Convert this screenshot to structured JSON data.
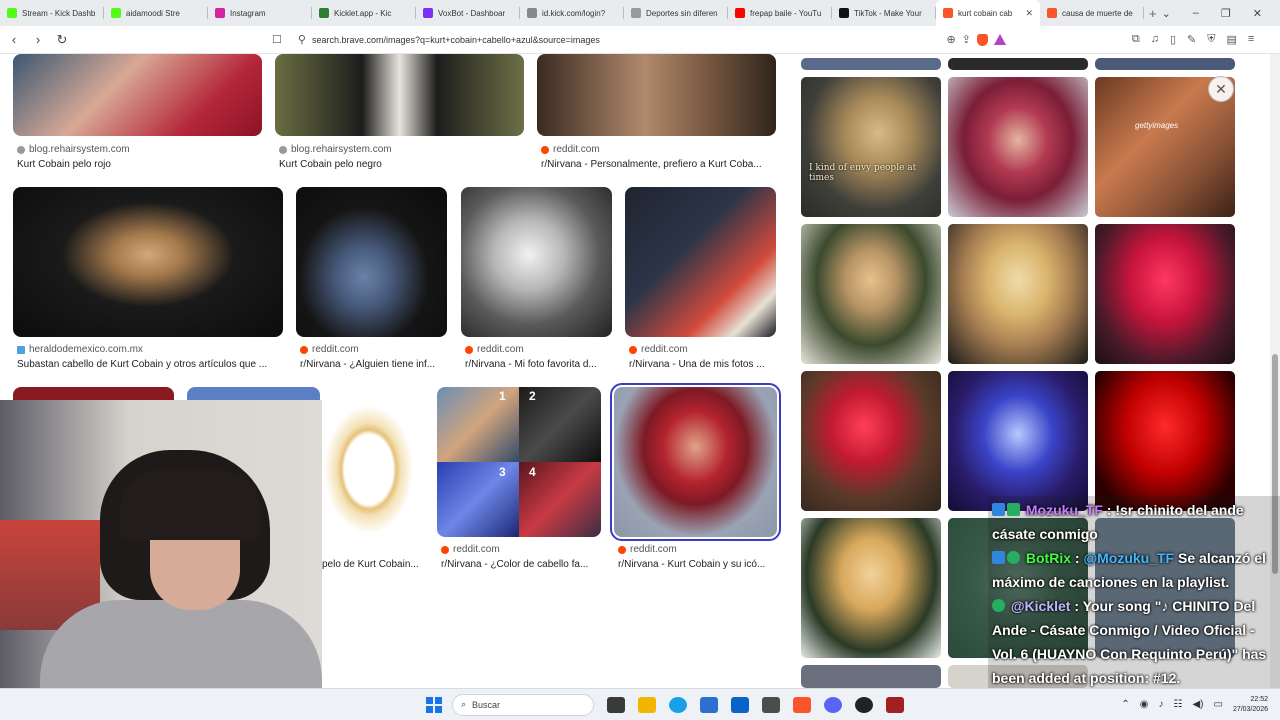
{
  "tabs": [
    {
      "label": "Stream - Kick Dashb",
      "color": "#53fc18",
      "active": false
    },
    {
      "label": "aidamoodi Stre",
      "color": "#53fc18",
      "active": false
    },
    {
      "label": "Instagram",
      "color": "#d6249f",
      "active": false
    },
    {
      "label": "Kicklet.app - Kic",
      "color": "#2e7d32",
      "active": false
    },
    {
      "label": "VoxBot - Dashboar",
      "color": "#7b2ff7",
      "active": false
    },
    {
      "label": "id.kick.com/login?",
      "color": "#888888",
      "active": false
    },
    {
      "label": "Deportes sin diferen",
      "color": "#999999",
      "active": false
    },
    {
      "label": "frepap baile - YouTu",
      "color": "#ff0000",
      "active": false
    },
    {
      "label": "TikTok - Make Your",
      "color": "#111111",
      "active": false
    },
    {
      "label": "kurt cobain cab",
      "color": "#fb542b",
      "active": true
    },
    {
      "label": "causa de muerte de",
      "color": "#fb542b",
      "active": false
    }
  ],
  "tab_close": "✕",
  "tab_plus": "+",
  "window_controls": [
    "⌄",
    "–",
    "❐",
    "✕"
  ],
  "toolbar": {
    "back": "‹",
    "forward": "›",
    "reload": "↻",
    "bookmark": "☐",
    "url": "search.brave.com/images?q=kurt+cobain+cabello+azul&source=images"
  },
  "results": [
    {
      "source": "blog.rehairsystem.com",
      "caption": "Kurt Cobain pelo rojo",
      "icon": "rehair-favicon",
      "color": "#9a9a9a"
    },
    {
      "source": "blog.rehairsystem.com",
      "caption": "Kurt Cobain pelo negro",
      "icon": "rehair-favicon",
      "color": "#9a9a9a"
    },
    {
      "source": "reddit.com",
      "caption": "r/Nirvana - Personalmente, prefiero a Kurt Coba...",
      "icon": "reddit-favicon",
      "color": "#ff4500"
    },
    {
      "source": "heraldodemexico.com.mx",
      "caption": "Subastan cabello de Kurt Cobain y otros artículos que ...",
      "icon": "heraldo-favicon",
      "color": "#4aa3df"
    },
    {
      "source": "reddit.com",
      "caption": "r/Nirvana - ¿Alguien tiene inf...",
      "icon": "reddit-favicon",
      "color": "#ff4500"
    },
    {
      "source": "reddit.com",
      "caption": "r/Nirvana - Mi foto favorita d...",
      "icon": "reddit-favicon",
      "color": "#ff4500"
    },
    {
      "source": "reddit.com",
      "caption": "r/Nirvana - Una de mis fotos ...",
      "icon": "reddit-favicon",
      "color": "#ff4500"
    },
    {
      "source": "",
      "caption": "pelo de Kurt Cobain...",
      "icon": "",
      "color": "#ffffff"
    },
    {
      "source": "reddit.com",
      "caption": "r/Nirvana - ¿Color de cabello fa...",
      "icon": "reddit-favicon",
      "color": "#ff4500"
    },
    {
      "source": "reddit.com",
      "caption": "r/Nirvana - Kurt Cobain y su icó...",
      "icon": "reddit-favicon",
      "color": "#ff4500"
    }
  ],
  "collage_numbers": [
    "1",
    "2",
    "3",
    "4"
  ],
  "panel": {
    "close": "✕",
    "image_text": "I kind of envy people at times",
    "getty": "gettyimages"
  },
  "chat": [
    {
      "user": "Mozuku_TF",
      "sep": " : ",
      "text": "!sr chinito del ande cásate conmigo",
      "badge_color": "#2e86de"
    },
    {
      "user": "BotRix",
      "sep": " : ",
      "mention": "@Mozuku_TF",
      "text": " Se alcanzó el máximo de canciones en la playlist.",
      "badge_color": "#27ae60"
    },
    {
      "user": "@Kicklet",
      "sep": " : ",
      "text": "Your song \"♪ CHINITO Del Ande - Cásate Conmigo / Video Oficial - Vol. 6 (HUAYNO Con Requinto Perú)\" has been added at position: #12.",
      "badge_color": "#27ae60"
    }
  ],
  "taskbar": {
    "search_label": "Buscar",
    "search_icon": "⌕",
    "tray_chevron": "⌃",
    "time": "22:52",
    "date": "27/03/2026"
  }
}
